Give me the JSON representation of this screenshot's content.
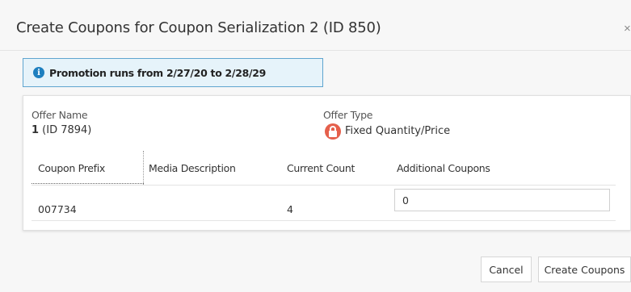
{
  "dialog": {
    "title": "Create Coupons for Coupon Serialization 2 (ID 850)",
    "close_glyph": "×"
  },
  "banner": {
    "icon": "info-icon",
    "text": "Promotion runs from 2/27/20 to 2/28/29"
  },
  "offer": {
    "name_label": "Offer Name",
    "name_value_bold": "1",
    "name_value_rest": " (ID 7894)",
    "type_label": "Offer Type",
    "type_icon": "lock-icon",
    "type_value": "Fixed Quantity/Price"
  },
  "table": {
    "columns": [
      "Coupon Prefix",
      "Media Description",
      "Current Count",
      "Additional Coupons"
    ],
    "rows": [
      {
        "coupon_prefix": "007734",
        "media_description": "",
        "current_count": "4",
        "additional_coupons": "0"
      }
    ]
  },
  "footer": {
    "cancel_label": "Cancel",
    "create_label": "Create Coupons"
  },
  "colors": {
    "accent": "#1e7fbf",
    "banner_bg": "#e6f3fa",
    "lock_red": "#e5604c"
  }
}
